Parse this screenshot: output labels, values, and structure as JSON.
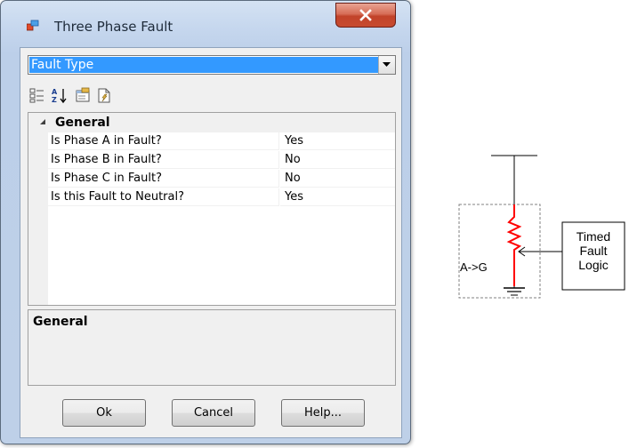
{
  "window": {
    "title": "Three Phase Fault"
  },
  "combo": {
    "selected": "Fault Type"
  },
  "toolbar": {
    "icons": [
      "categorized-icon",
      "alphabetical-sort-icon",
      "property-pages-icon",
      "events-icon"
    ]
  },
  "grid": {
    "category": "General",
    "properties": [
      {
        "name": "Is Phase A in Fault?",
        "value": "Yes"
      },
      {
        "name": "Is Phase B in Fault?",
        "value": "No"
      },
      {
        "name": "Is Phase C in Fault?",
        "value": "No"
      },
      {
        "name": "Is this Fault to Neutral?",
        "value": "Yes"
      }
    ]
  },
  "description": {
    "title": "General"
  },
  "buttons": {
    "ok": "Ok",
    "cancel": "Cancel",
    "help": "Help..."
  },
  "schematic": {
    "fault_label": "A->G",
    "logic_box_lines": [
      "Timed",
      "Fault",
      "Logic"
    ],
    "colors": {
      "fault": "#ff0000",
      "wire": "#000000",
      "box_border": "#808080"
    }
  }
}
